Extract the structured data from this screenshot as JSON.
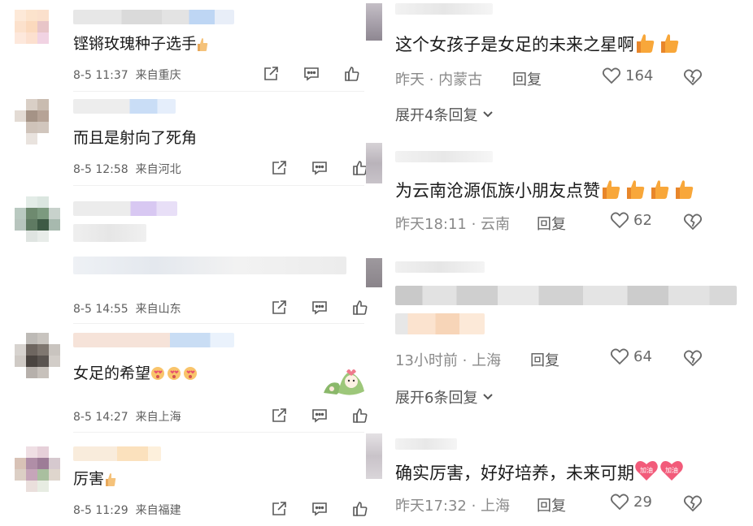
{
  "left_comments": [
    {
      "text": "铿锵玫瑰种子选手",
      "date": "8-5 11:37",
      "location": "来自重庆"
    },
    {
      "text": "而且是射向了死角",
      "date": "8-5 12:58",
      "location": "来自河北"
    },
    {
      "text": "",
      "date": "8-5 14:55",
      "location": "来自山东"
    },
    {
      "text": "女足的希望",
      "date": "8-5 14:27",
      "location": "来自上海"
    },
    {
      "text": "厉害",
      "date": "8-5 11:29",
      "location": "来自福建"
    }
  ],
  "right_comments": [
    {
      "text": "这个女孩子是女足的未来之星啊",
      "time": "昨天 · 内蒙古",
      "reply": "回复",
      "likes": "164"
    },
    {
      "text": "为云南沧源佤族小朋友点赞",
      "time": "昨天18:11 · 云南",
      "reply": "回复",
      "likes": "62"
    },
    {
      "text": "",
      "time": "13小时前 · 上海",
      "reply": "回复",
      "likes": "64"
    },
    {
      "text": "确实厉害，好好培养，未来可期",
      "time": "昨天17:32 · 上海",
      "reply": "回复",
      "likes": "29"
    }
  ],
  "expand_labels": {
    "first": "展开4条回复",
    "second": "展开6条回复"
  },
  "sticker_text": {
    "jiayou": "加油"
  },
  "colors": {
    "meta": "#5f5f5f",
    "thumb": "#f5a623",
    "heart": "#666666"
  }
}
